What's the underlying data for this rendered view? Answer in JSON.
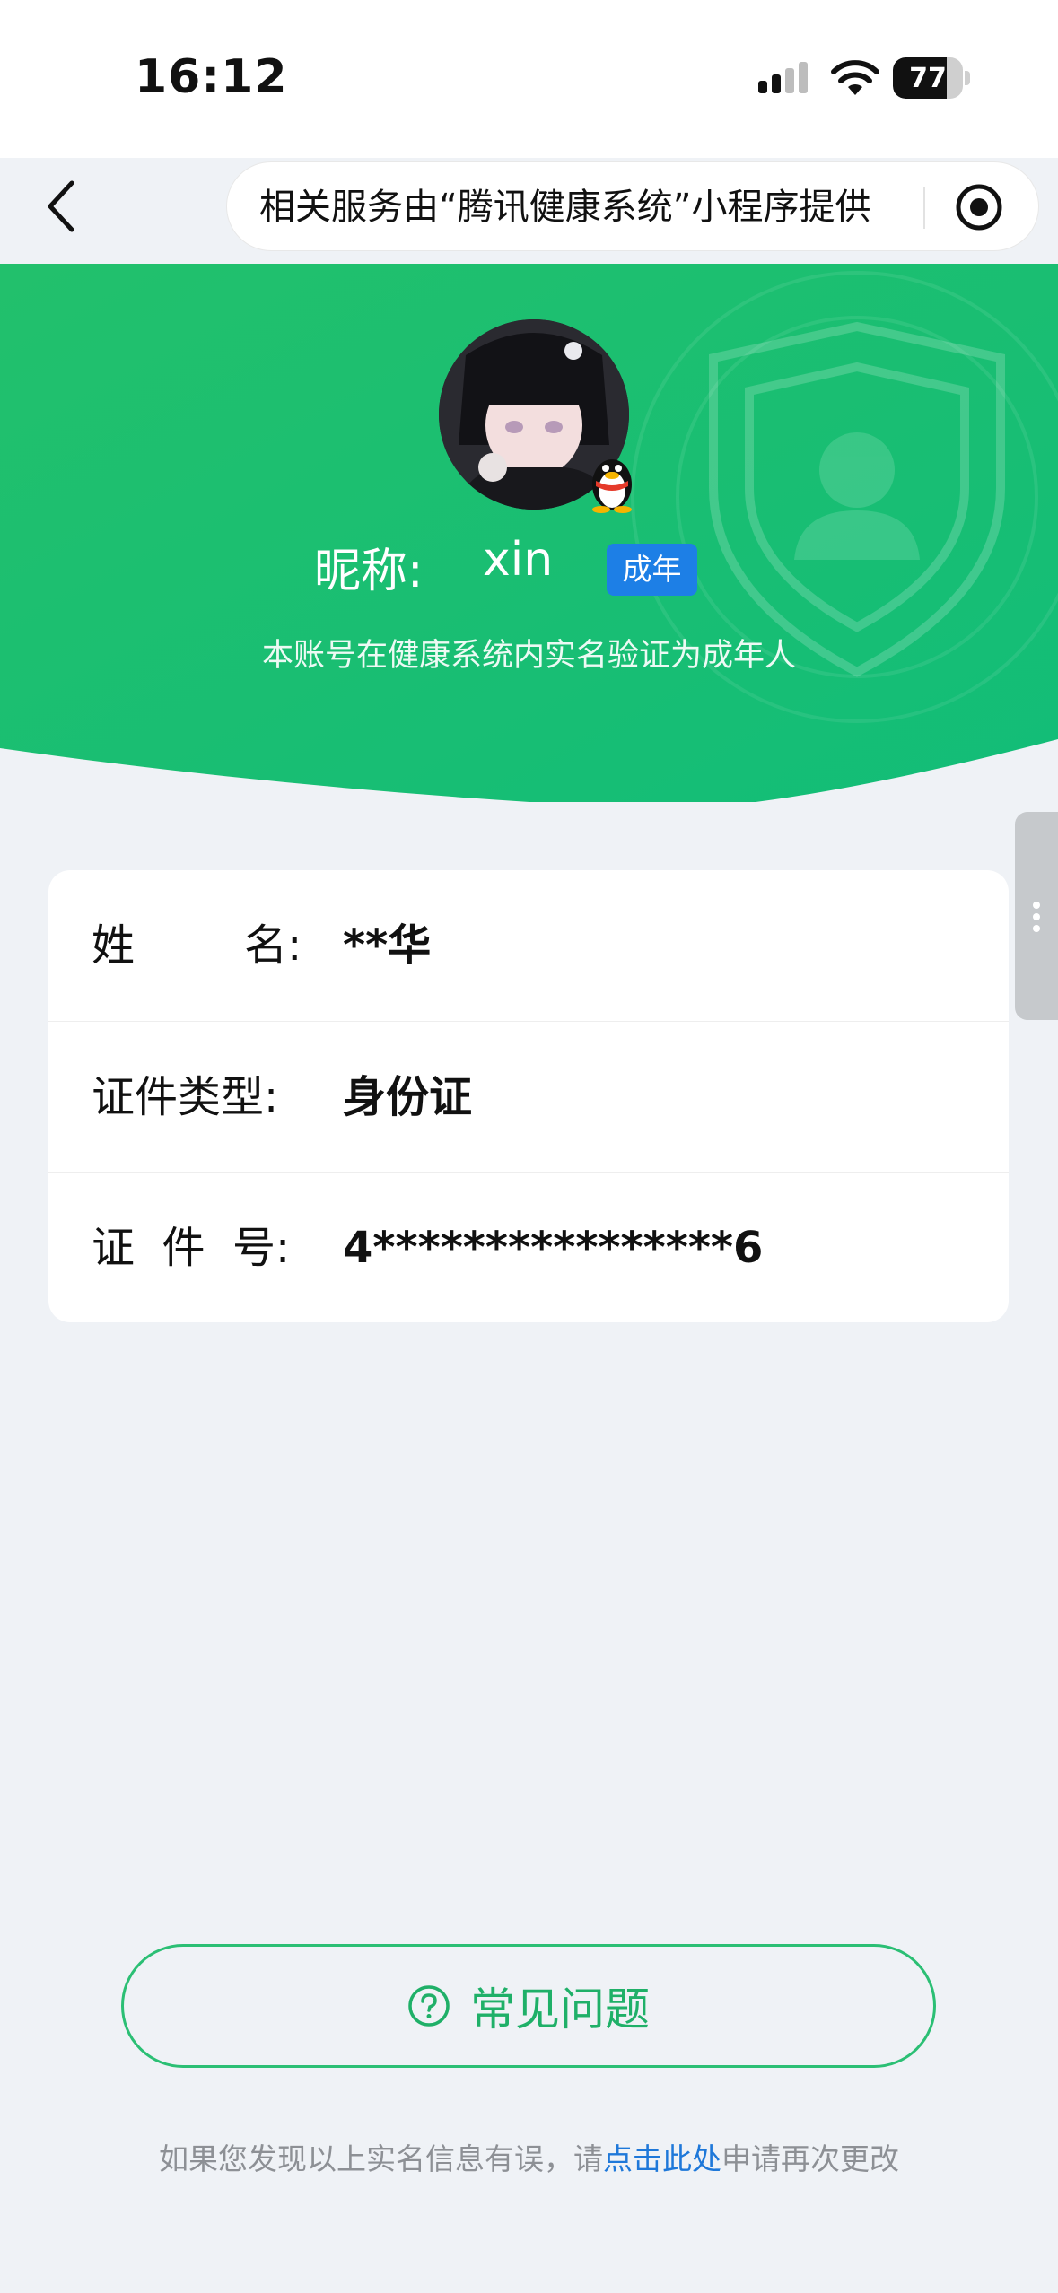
{
  "status_bar": {
    "time": "16:12",
    "battery_level": "77",
    "battery_fraction": 0.77
  },
  "nav": {
    "back_icon": "chevron-left-icon",
    "capsule_text": "相关服务由“腾讯健康系统”小程序提供",
    "record_icon": "record-target-icon"
  },
  "profile": {
    "nickname_label": "昵称:",
    "nickname": "xin",
    "age_tag": "成年",
    "verify_note": "本账号在健康系统内实名验证为成年人",
    "badge_icon": "qq-penguin-icon",
    "hero_color": "#1fbf6e",
    "tag_color": "#1d7fe6"
  },
  "identity": {
    "rows": [
      {
        "label": "姓        名:",
        "value": "**华"
      },
      {
        "label": "证件类型:",
        "value": "身份证"
      },
      {
        "label": "证  件  号:",
        "value": "4****************6"
      }
    ]
  },
  "faq": {
    "label": "常见问题",
    "icon": "question-circle-icon",
    "color": "#1fb068"
  },
  "footer": {
    "prefix": "如果您发现以上实名信息有误，请",
    "link": "点击此处",
    "suffix": "申请再次更改",
    "link_color": "#1e78d9"
  }
}
